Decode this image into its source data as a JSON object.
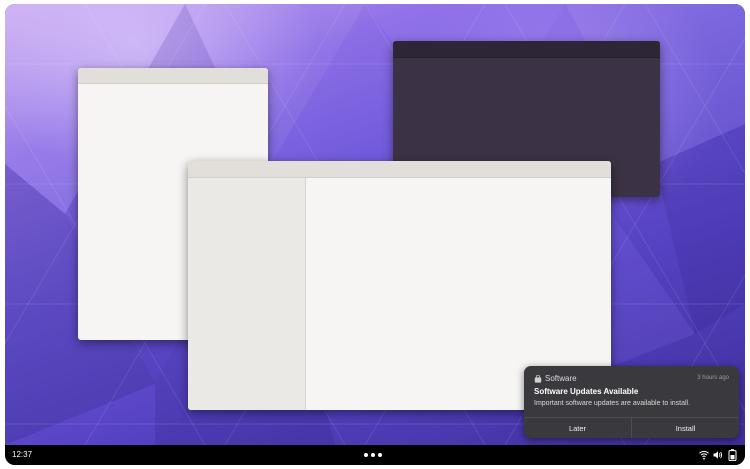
{
  "notification": {
    "app_name": "Software",
    "time": "3 hours ago",
    "title": "Software Updates Available",
    "body": "Important software updates are available to install.",
    "actions": {
      "later": "Later",
      "install": "Install"
    },
    "icon": "shopping-bag-icon"
  },
  "panel": {
    "clock": "12:37",
    "center_icon": "app-grid-dots-icon",
    "status_icons": [
      "wifi-icon",
      "volume-icon",
      "battery-icon"
    ]
  },
  "colors": {
    "wallpaper_accent": "#6a55d8",
    "light_window": "#f6f5f3",
    "dark_window": "#3b3245",
    "notification_bg": "#3a3a3e",
    "panel_bg": "#000000"
  }
}
